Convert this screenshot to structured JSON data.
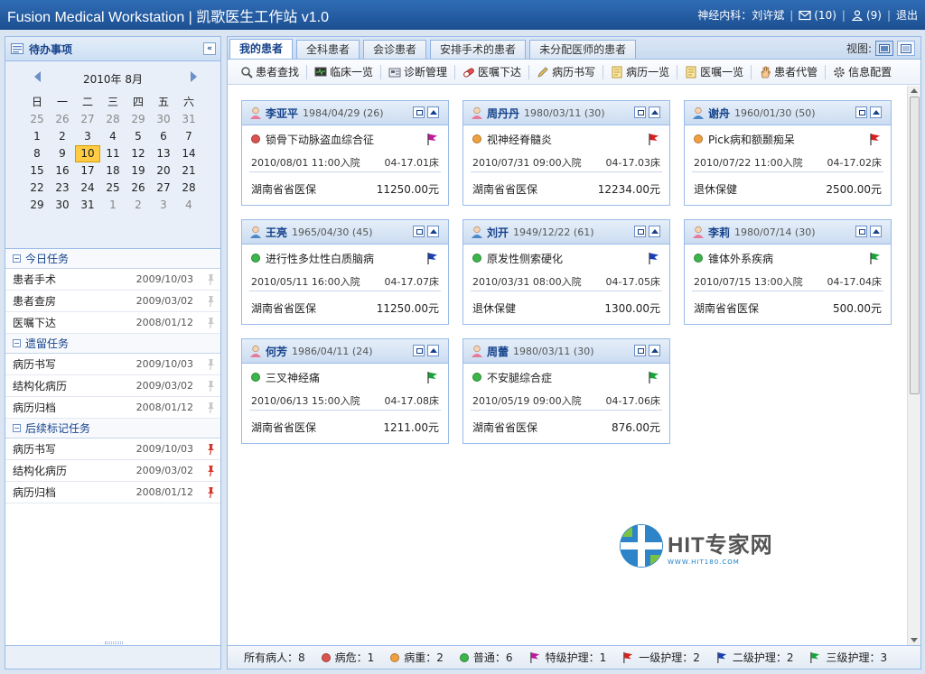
{
  "app": {
    "title": "Fusion Medical Workstation | 凯歌医生工作站 v1.0",
    "user": "神经内科：刘许斌",
    "mail_count": "(10)",
    "people_count": "(9)",
    "logout": "退出"
  },
  "left": {
    "title": "待办事项",
    "calendar": {
      "month_label": "2010年 8月",
      "weekdays": [
        "日",
        "一",
        "二",
        "三",
        "四",
        "五",
        "六"
      ],
      "days": [
        "25",
        "26",
        "27",
        "28",
        "29",
        "30",
        "31",
        "1",
        "2",
        "3",
        "4",
        "5",
        "6",
        "7",
        "8",
        "9",
        "10",
        "11",
        "12",
        "13",
        "14",
        "15",
        "16",
        "17",
        "18",
        "19",
        "20",
        "21",
        "22",
        "23",
        "24",
        "25",
        "26",
        "27",
        "28",
        "29",
        "30",
        "31",
        "1",
        "2",
        "3",
        "4"
      ],
      "today": "10"
    },
    "sections": [
      {
        "title": "今日任务",
        "items": [
          {
            "name": "患者手术",
            "date": "2009/10/03"
          },
          {
            "name": "患者查房",
            "date": "2009/03/02"
          },
          {
            "name": "医嘱下达",
            "date": "2008/01/12"
          }
        ]
      },
      {
        "title": "遗留任务",
        "items": [
          {
            "name": "病历书写",
            "date": "2009/10/03"
          },
          {
            "name": "结构化病历",
            "date": "2009/03/02"
          },
          {
            "name": "病历归档",
            "date": "2008/01/12"
          }
        ]
      },
      {
        "title": "后续标记任务",
        "items": [
          {
            "name": "病历书写",
            "date": "2009/10/03"
          },
          {
            "name": "结构化病历",
            "date": "2009/03/02"
          },
          {
            "name": "病历归档",
            "date": "2008/01/12"
          }
        ]
      }
    ]
  },
  "tabs": [
    "我的患者",
    "全科患者",
    "会诊患者",
    "安排手术的患者",
    "未分配医师的患者"
  ],
  "view_label": "视图:",
  "toolbar": [
    "患者查找",
    "临床一览",
    "诊断管理",
    "医嘱下达",
    "病历书写",
    "病历一览",
    "医嘱一览",
    "患者代管",
    "信息配置"
  ],
  "patients": [
    {
      "name": "李亚平",
      "info": "1984/04/29 (26)",
      "gender": "female",
      "status": "critical",
      "diagnosis": "锁骨下动脉盗血综合征",
      "flag": "special",
      "admit": "2010/08/01 11:00入院",
      "bed": "04-17.01床",
      "insurance": "湖南省省医保",
      "amount": "11250.00元"
    },
    {
      "name": "周丹丹",
      "info": "1980/03/11 (30)",
      "gender": "female",
      "status": "serious",
      "diagnosis": "视神经脊髓炎",
      "flag": "level1",
      "admit": "2010/07/31 09:00入院",
      "bed": "04-17.03床",
      "insurance": "湖南省省医保",
      "amount": "12234.00元"
    },
    {
      "name": "谢舟",
      "info": "1960/01/30 (50)",
      "gender": "male",
      "status": "serious",
      "diagnosis": "Pick病和额颞痴呆",
      "flag": "level1",
      "admit": "2010/07/22 11:00入院",
      "bed": "04-17.02床",
      "insurance": "退休保健",
      "amount": "2500.00元"
    },
    {
      "name": "王亮",
      "info": "1965/04/30 (45)",
      "gender": "male",
      "status": "normal",
      "diagnosis": "进行性多灶性白质脑病",
      "flag": "level2",
      "admit": "2010/05/11 16:00入院",
      "bed": "04-17.07床",
      "insurance": "湖南省省医保",
      "amount": "11250.00元"
    },
    {
      "name": "刘开",
      "info": "1949/12/22 (61)",
      "gender": "male",
      "status": "normal",
      "diagnosis": "原发性侧索硬化",
      "flag": "level2",
      "admit": "2010/03/31 08:00入院",
      "bed": "04-17.05床",
      "insurance": "退休保健",
      "amount": "1300.00元"
    },
    {
      "name": "李莉",
      "info": "1980/07/14 (30)",
      "gender": "female",
      "status": "normal",
      "diagnosis": "锥体外系疾病",
      "flag": "level3",
      "admit": "2010/07/15 13:00入院",
      "bed": "04-17.04床",
      "insurance": "湖南省省医保",
      "amount": "500.00元"
    },
    {
      "name": "何芳",
      "info": "1986/04/11 (24)",
      "gender": "female",
      "status": "normal",
      "diagnosis": "三叉神经痛",
      "flag": "level3",
      "admit": "2010/06/13 15:00入院",
      "bed": "04-17.08床",
      "insurance": "湖南省省医保",
      "amount": "1211.00元"
    },
    {
      "name": "周蕾",
      "info": "1980/03/11 (30)",
      "gender": "female",
      "status": "normal",
      "diagnosis": "不安腿综合症",
      "flag": "level3",
      "admit": "2010/05/19 09:00入院",
      "bed": "04-17.06床",
      "insurance": "湖南省省医保",
      "amount": "876.00元"
    }
  ],
  "watermark": {
    "name": "HIT专家网",
    "url": "WWW.HIT180.COM"
  },
  "status": {
    "total": "所有病人：8",
    "critical": "病危：1",
    "serious": "病重：2",
    "normal": "普通：6",
    "special": "特级护理：1",
    "level1": "一级护理：2",
    "level2": "二级护理：2",
    "level3": "三级护理：3"
  },
  "colors": {
    "critical": "#d9534f",
    "serious": "#f0a040",
    "normal": "#3cb54a",
    "flag_special": "#c0189a",
    "flag_level1": "#d62020",
    "flag_level2": "#1a3fb5",
    "flag_level3": "#19a33a"
  }
}
